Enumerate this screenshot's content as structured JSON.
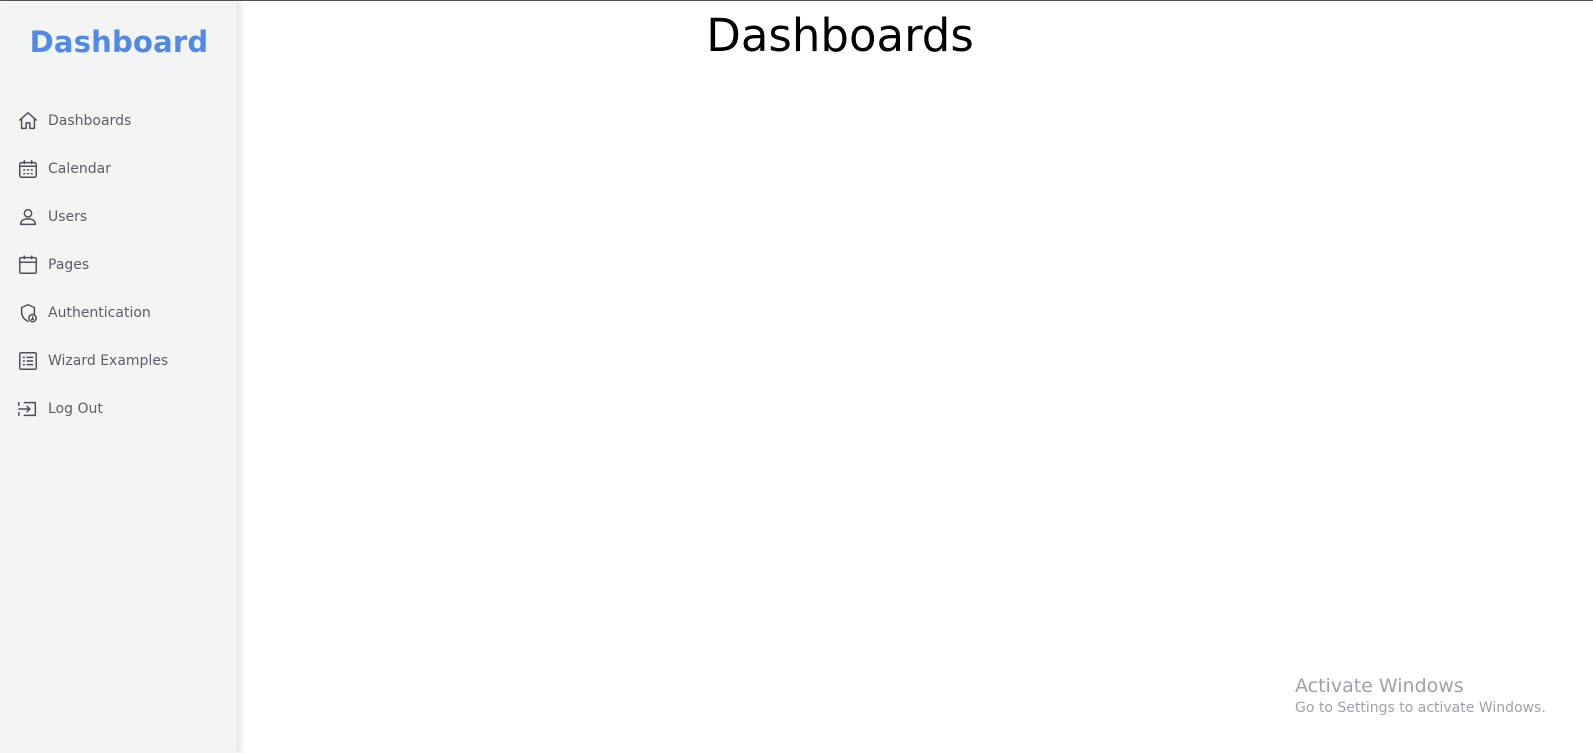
{
  "sidebar": {
    "brand": "Dashboard",
    "items": [
      {
        "label": "Dashboards",
        "icon": "home-icon"
      },
      {
        "label": "Calendar",
        "icon": "calendar-icon"
      },
      {
        "label": "Users",
        "icon": "user-icon"
      },
      {
        "label": "Pages",
        "icon": "page-icon"
      },
      {
        "label": "Authentication",
        "icon": "shield-lock-icon"
      },
      {
        "label": "Wizard Examples",
        "icon": "list-icon"
      },
      {
        "label": "Log Out",
        "icon": "logout-icon"
      }
    ]
  },
  "main": {
    "title": "Dashboards"
  },
  "watermark": {
    "title": "Activate Windows",
    "subtitle": "Go to Settings to activate Windows."
  },
  "colors": {
    "brand": "#5089e8",
    "sidebar_bg": "#f3f4f4",
    "nav_text": "#5a5f6a",
    "icon": "#4b4f5c"
  }
}
